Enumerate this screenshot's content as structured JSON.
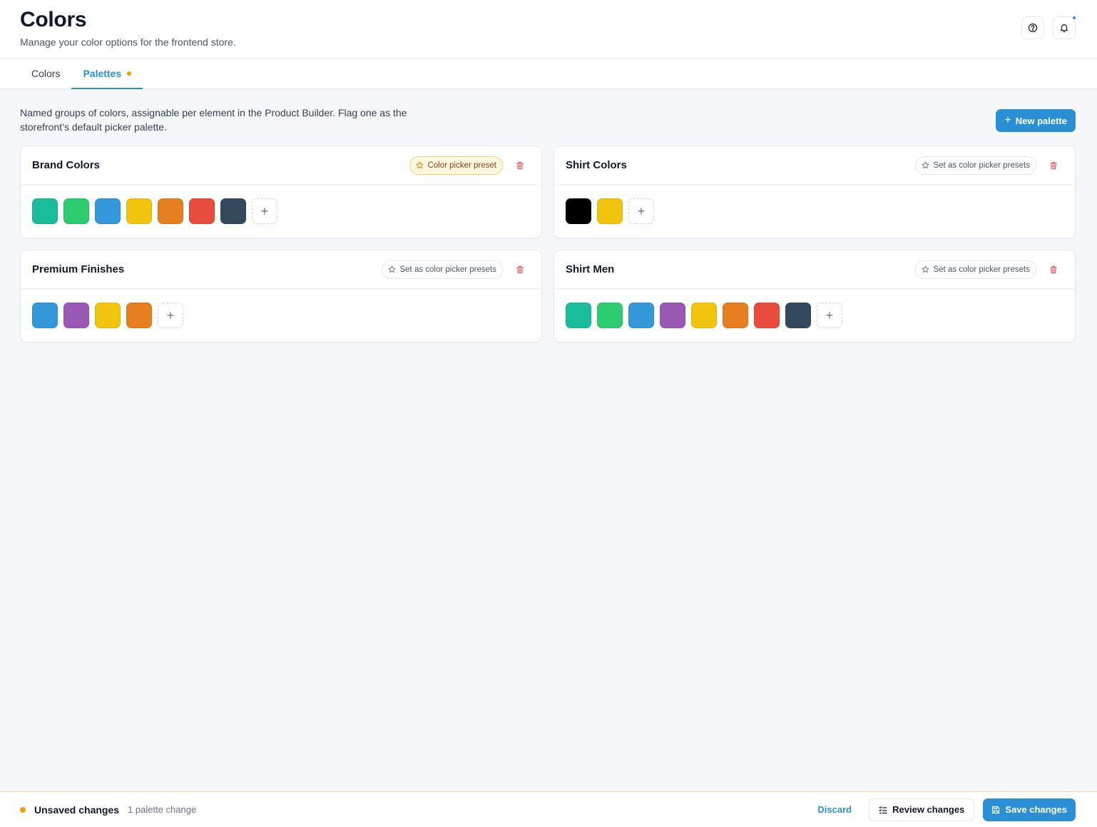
{
  "header": {
    "title": "Colors",
    "subtitle": "Manage your color options for the frontend store.",
    "help_icon": "help-circle-icon",
    "notification_icon": "bell-icon"
  },
  "tabs": [
    {
      "label": "Colors",
      "active": false
    },
    {
      "label": "Palettes",
      "active": true,
      "has_unsaved_indicator": true
    }
  ],
  "intro_text": "Named groups of colors, assignable per element in the Product Builder. Flag one as the storefront’s default picker palette.",
  "new_palette_label": "New palette",
  "palettes": [
    {
      "name": "Brand Colors",
      "preset_label": "Color picker preset",
      "is_preset": true,
      "colors": [
        "#1abc9c",
        "#2ecc71",
        "#3498db",
        "#f1c40f",
        "#e67e22",
        "#e74c3c",
        "#34495e"
      ]
    },
    {
      "name": "Shirt Colors",
      "preset_label": "Set as color picker presets",
      "is_preset": false,
      "colors": [
        "#000000",
        "#f1c40f"
      ]
    },
    {
      "name": "Premium Finishes",
      "preset_label": "Set as color picker presets",
      "is_preset": false,
      "colors": [
        "#3498db",
        "#9b59b6",
        "#f1c40f",
        "#e67e22"
      ]
    },
    {
      "name": "Shirt Men",
      "preset_label": "Set as color picker presets",
      "is_preset": false,
      "colors": [
        "#1abc9c",
        "#2ecc71",
        "#3498db",
        "#9b59b6",
        "#f1c40f",
        "#e67e22",
        "#e74c3c",
        "#34495e"
      ]
    }
  ],
  "footer": {
    "status": "Unsaved changes",
    "change_count": "1 palette change",
    "discard_label": "Discard",
    "review_label": "Review changes",
    "save_label": "Save changes"
  },
  "colors": {
    "accent": "#2b8fd6",
    "warning": "#f59e0b",
    "danger": "#e5484d"
  }
}
